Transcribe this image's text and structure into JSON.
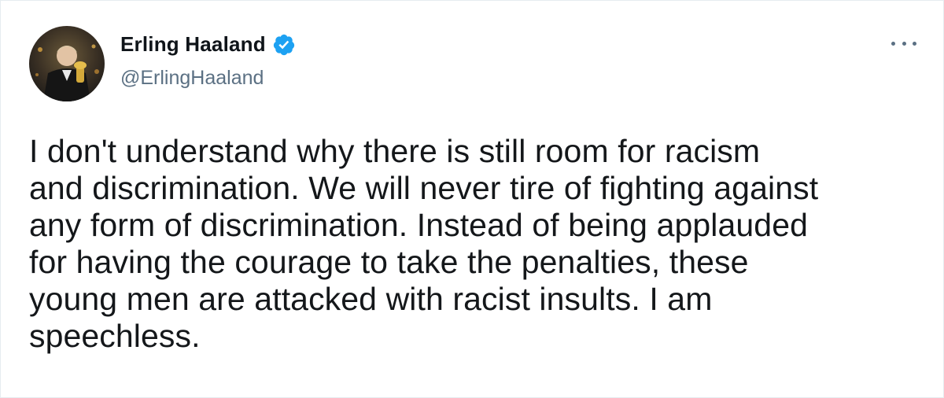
{
  "tweet": {
    "author": {
      "display_name": "Erling Haaland",
      "handle": "@ErlingHaaland",
      "verified": true,
      "avatar_icon": "profile-photo-icon"
    },
    "more_icon": "more-options-icon",
    "text": "I don't understand why there is still room for racism\nand discrimination. We will never tire of fighting against\nany form of discrimination. Instead of being applauded\nfor having the courage to take the penalties, these\nyoung men are attacked with racist insults. I am\nspeechless."
  },
  "colors": {
    "text_primary": "#0f1419",
    "text_secondary": "#5b7083",
    "verified_badge": "#1da1f2"
  }
}
